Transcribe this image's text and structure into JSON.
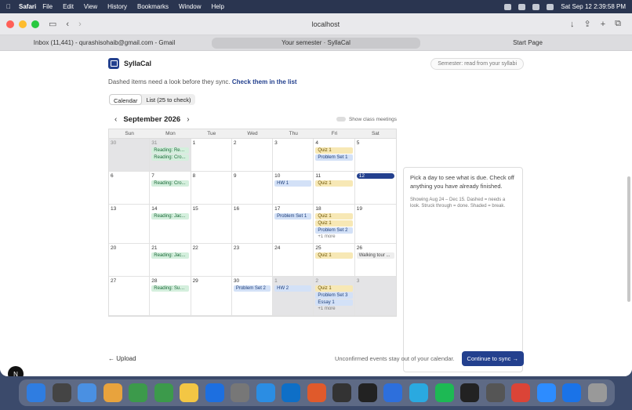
{
  "menubar": {
    "app": "Safari",
    "items": [
      "File",
      "Edit",
      "View",
      "History",
      "Bookmarks",
      "Window",
      "Help"
    ],
    "clock": "Sat Sep 12  2:39:58 PM"
  },
  "browser": {
    "url": "localhost",
    "tabs": [
      {
        "label": "Inbox (11,441) - qurashisohaib@gmail.com - Gmail"
      },
      {
        "label": "Your semester · SyllaCal"
      },
      {
        "label": "Start Page"
      }
    ]
  },
  "app": {
    "brand": "SyllaCal",
    "semester_badge": "Semester: read from your syllabi",
    "note": "Dashed items need a look before they sync.",
    "note_link": "Check them in the list",
    "view_tabs": [
      "Calendar",
      "List (25 to check)"
    ],
    "month": "September 2026",
    "prev": "‹",
    "next": "›",
    "toggle_label": "Show class meetings",
    "weekdays": [
      "Sun",
      "Mon",
      "Tue",
      "Wed",
      "Thu",
      "Fri",
      "Sat"
    ],
    "weeks": [
      [
        {
          "d": "30",
          "out": true,
          "ev": []
        },
        {
          "d": "31",
          "out": true,
          "ev": [
            [
              "rd",
              "Reading: Res..."
            ],
            [
              "rd",
              "Reading: Cro..."
            ]
          ]
        },
        {
          "d": "1",
          "ev": []
        },
        {
          "d": "2",
          "ev": []
        },
        {
          "d": "3",
          "ev": []
        },
        {
          "d": "4",
          "ev": [
            [
              "quiz",
              "Quiz 1"
            ],
            [
              "ps",
              "Problem Set 1"
            ]
          ]
        },
        {
          "d": "5",
          "ev": []
        }
      ],
      [
        {
          "d": "6",
          "ev": []
        },
        {
          "d": "7",
          "ev": [
            [
              "rd",
              "Reading: Cro..."
            ]
          ]
        },
        {
          "d": "8",
          "ev": []
        },
        {
          "d": "9",
          "ev": []
        },
        {
          "d": "10",
          "ev": [
            [
              "ps",
              "HW 1"
            ]
          ]
        },
        {
          "d": "11",
          "ev": [
            [
              "quiz",
              "Quiz 1"
            ]
          ]
        },
        {
          "d": "12",
          "today": true,
          "ev": []
        }
      ],
      [
        {
          "d": "13",
          "ev": []
        },
        {
          "d": "14",
          "ev": [
            [
              "rd",
              "Reading: Jac..."
            ]
          ]
        },
        {
          "d": "15",
          "ev": []
        },
        {
          "d": "16",
          "ev": []
        },
        {
          "d": "17",
          "ev": [
            [
              "ps",
              "Problem Set 1"
            ]
          ]
        },
        {
          "d": "18",
          "ev": [
            [
              "quiz",
              "Quiz 1"
            ],
            [
              "quiz",
              "Quiz 1"
            ],
            [
              "ps",
              "Problem Set 2"
            ],
            [
              "more",
              "+1 more"
            ]
          ]
        },
        {
          "d": "19",
          "ev": []
        }
      ],
      [
        {
          "d": "20",
          "ev": []
        },
        {
          "d": "21",
          "ev": [
            [
              "rd",
              "Reading: Jac..."
            ]
          ]
        },
        {
          "d": "22",
          "ev": []
        },
        {
          "d": "23",
          "ev": []
        },
        {
          "d": "24",
          "ev": []
        },
        {
          "d": "25",
          "ev": [
            [
              "quiz",
              "Quiz 1"
            ]
          ]
        },
        {
          "d": "26",
          "ev": [
            [
              "gr",
              "Walking tour ..."
            ]
          ]
        }
      ],
      [
        {
          "d": "27",
          "ev": []
        },
        {
          "d": "28",
          "ev": [
            [
              "rd",
              "Reading: Sug..."
            ]
          ]
        },
        {
          "d": "29",
          "ev": []
        },
        {
          "d": "30",
          "ev": [
            [
              "ps",
              "Problem Set 2"
            ]
          ]
        },
        {
          "d": "1",
          "out": true,
          "ev": [
            [
              "ps",
              "HW 2"
            ]
          ]
        },
        {
          "d": "2",
          "out": true,
          "ev": [
            [
              "quiz",
              "Quiz 1"
            ],
            [
              "ps",
              "Problem Set 3"
            ],
            [
              "ps",
              "Essay 1"
            ],
            [
              "more",
              "+1 more"
            ]
          ]
        },
        {
          "d": "3",
          "out": true,
          "ev": []
        }
      ]
    ],
    "side_text": "Pick a day to see what is due. Check off anything you have already finished.",
    "side_hint": "Showing Aug 24 – Dec 15. Dashed = needs a look. Struck through = done. Shaded = break.",
    "upload_label": "← Upload",
    "footer_msg": "Unconfirmed events stay out of your calendar.",
    "sync_label": "Continue to sync →"
  },
  "colors": {
    "accent": "#23408e"
  }
}
